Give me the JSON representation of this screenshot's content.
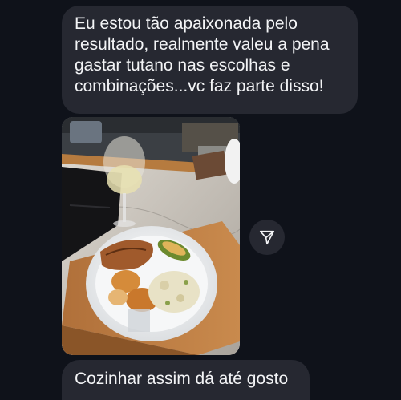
{
  "messages": [
    {
      "type": "text",
      "text": "Eu estou tão apaixonada pelo resultado, realmente valeu a pena gastar tutano nas escolhas e combinações...vc faz parte disso!"
    },
    {
      "type": "image",
      "image_icon": "food-photo"
    },
    {
      "type": "text",
      "text": "Cozinhar assim dá até gosto"
    }
  ],
  "actions": {
    "share_icon": "paper-plane-icon"
  },
  "colors": {
    "background": "#0f121a",
    "bubble": "#262831",
    "text": "#f3f4f6"
  }
}
